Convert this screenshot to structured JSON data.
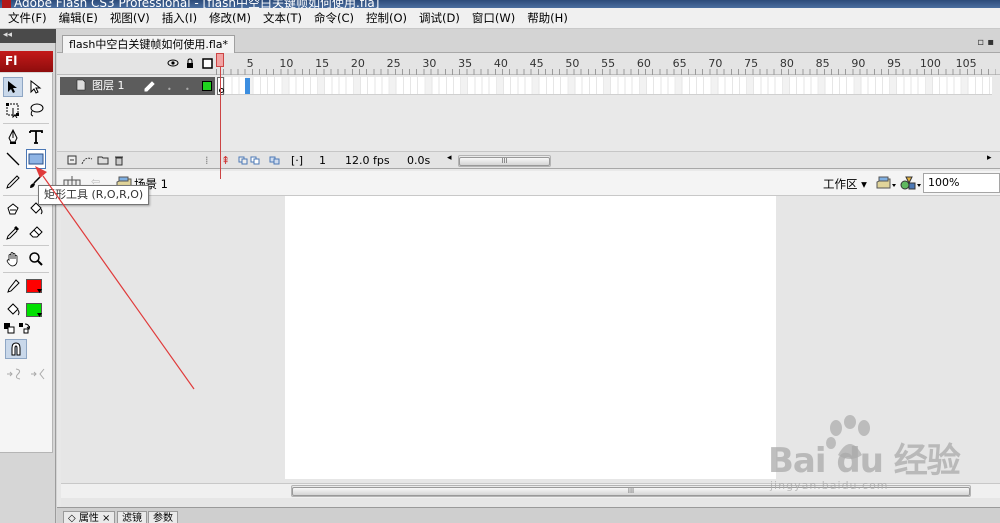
{
  "window": {
    "title": "Adobe Flash CS3 Professional - [flash中空白关键帧如何使用.fla]"
  },
  "menu": [
    "文件(F)",
    "编辑(E)",
    "视图(V)",
    "插入(I)",
    "修改(M)",
    "文本(T)",
    "命令(C)",
    "控制(O)",
    "调试(D)",
    "窗口(W)",
    "帮助(H)"
  ],
  "tools": {
    "panel_collapse": "◂◂",
    "logo": "Fl",
    "tooltip": "矩形工具 (R,O,R,O)",
    "stroke_color": "#ff0000",
    "fill_color": "#00e000"
  },
  "document": {
    "tab_label": "flash中空白关键帧如何使用.fla*",
    "window_controls": "▫ ▪"
  },
  "timeline": {
    "ruler": [
      "1",
      "5",
      "10",
      "15",
      "20",
      "25",
      "30",
      "35",
      "40",
      "45",
      "50",
      "55",
      "60",
      "65",
      "70",
      "75",
      "80",
      "85",
      "90",
      "95",
      "100",
      "105"
    ],
    "layer_name": "图层 1",
    "current_frame": "1",
    "fps": "12.0 fps",
    "elapsed": "0.0s"
  },
  "editbar": {
    "scene": "场景 1",
    "workspace": "工作区",
    "zoom": "100%"
  },
  "properties": {
    "tabs": [
      "属性",
      "滤镜",
      "参数"
    ]
  },
  "watermark": {
    "main": "Bai du 经验",
    "sub": "jingyan.baidu.com"
  },
  "colors": {
    "accent": "#4b78b6",
    "annotation": "#e03a3a",
    "layer_bg": "#5c5c5c"
  }
}
